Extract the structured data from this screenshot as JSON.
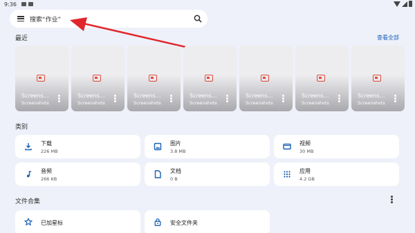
{
  "status_bar": {
    "time": "9:36"
  },
  "search": {
    "placeholder": "搜索“作业”"
  },
  "recent": {
    "title": "最近",
    "view_all": "查看全部",
    "items": [
      {
        "title": "Screens…",
        "subtitle": "Screenshots"
      },
      {
        "title": "Screens…",
        "subtitle": "Screenshots"
      },
      {
        "title": "Screens…",
        "subtitle": "Screenshots"
      },
      {
        "title": "Screens…",
        "subtitle": "Screenshots"
      },
      {
        "title": "Screens…",
        "subtitle": "Screenshots"
      },
      {
        "title": "Screens…",
        "subtitle": "Screenshots"
      },
      {
        "title": "Screens…",
        "subtitle": "Screenshots"
      }
    ]
  },
  "categories": {
    "title": "类别",
    "items": [
      {
        "name": "下载",
        "size": "226 MB",
        "icon": "download-icon"
      },
      {
        "name": "图片",
        "size": "3.8 MB",
        "icon": "image-icon"
      },
      {
        "name": "视频",
        "size": "30 MB",
        "icon": "video-icon"
      },
      {
        "name": "音频",
        "size": "266 KB",
        "icon": "music-icon"
      },
      {
        "name": "文档",
        "size": "0 B",
        "icon": "document-icon"
      },
      {
        "name": "应用",
        "size": "4.2 GB",
        "icon": "apps-icon"
      }
    ]
  },
  "collections": {
    "title": "文件合集",
    "items": [
      {
        "name": "已加星标",
        "icon": "star-icon"
      },
      {
        "name": "安全文件夹",
        "icon": "lock-icon"
      }
    ]
  },
  "colors": {
    "accent": "#1a5fb4",
    "annotation_arrow": "#e0262c",
    "background": "#eef1f9"
  }
}
